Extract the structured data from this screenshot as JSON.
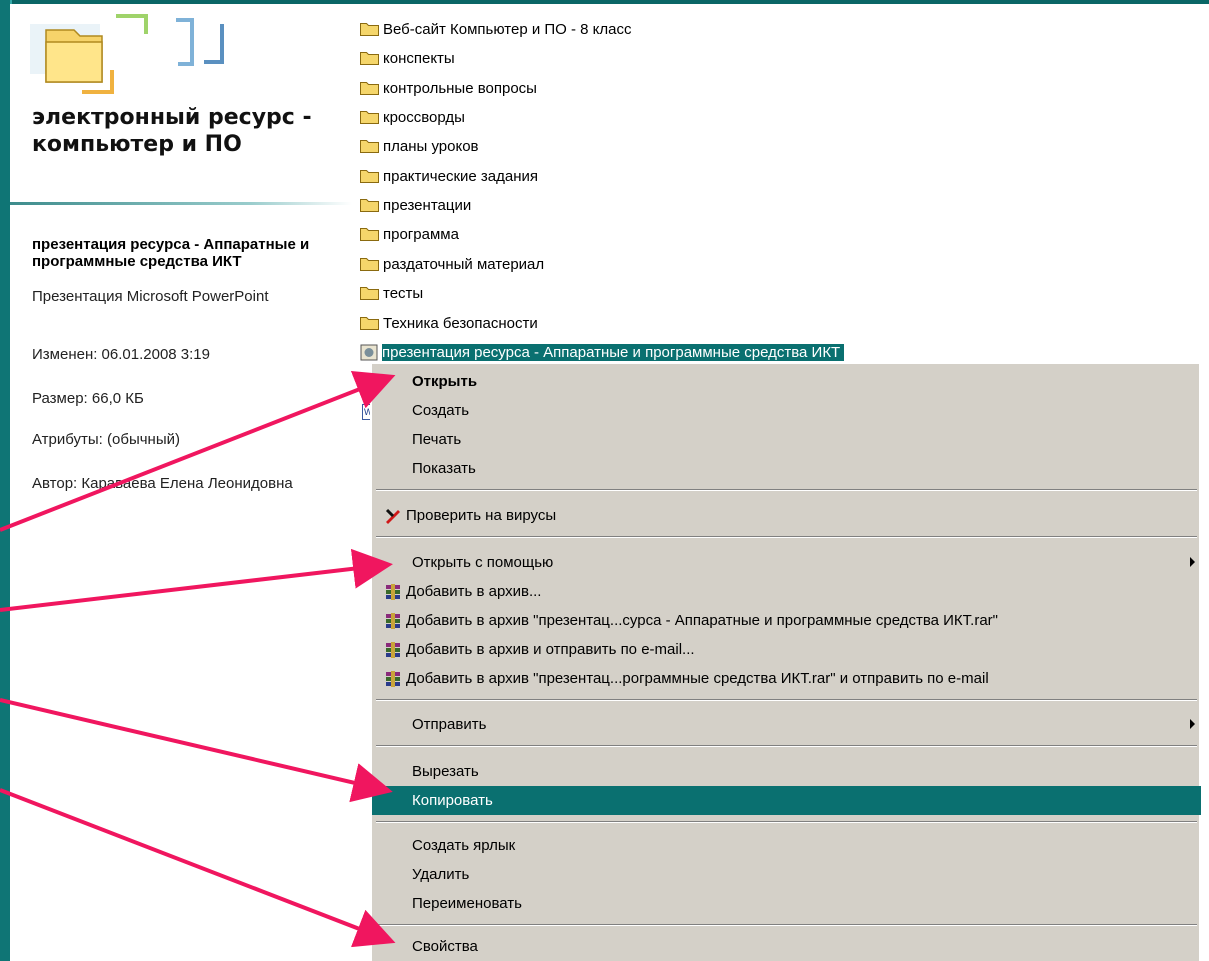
{
  "details_pane": {
    "title": "электронный ресурс - компьютер и ПО",
    "file_title": "презентация ресурса - Аппаратные и программные средства ИКТ",
    "file_type": "Презентация Microsoft PowerPoint",
    "modified": "Изменен: 06.01.2008 3:19",
    "size": "Размер: 66,0 КБ",
    "attributes": "Атрибуты: (обычный)",
    "author": "Автор: Караваева Елена Леонидовна"
  },
  "file_list": {
    "folders": [
      "Веб-сайт Компьютер и ПО - 8 класс",
      "конспекты",
      "контрольные вопросы",
      "кроссворды",
      "планы уроков",
      "практические задания",
      "презентации",
      "программа",
      "раздаточный материал",
      "тесты",
      "Техника безопасности"
    ],
    "selected_file": "презентация ресурса - Аппаратные и программные средства ИКТ",
    "icons": {
      "folder": "folder-icon",
      "presentation": "powerpoint-icon",
      "document": "word-document-icon"
    }
  },
  "context_menu": {
    "open": "Открыть",
    "create": "Создать",
    "print": "Печать",
    "show": "Показать",
    "virus_check": "Проверить на вирусы",
    "open_with": "Открыть с помощью",
    "add_to_archive": "Добавить в архив...",
    "add_to_named_archive": "Добавить в архив \"презентац...сурса - Аппаратные и программные средства ИКТ.rar\"",
    "add_and_email": "Добавить в архив и отправить по e-mail...",
    "add_named_and_email": "Добавить в архив \"презентац...рограммные средства ИКТ.rar\" и отправить по e-mail",
    "send_to": "Отправить",
    "cut": "Вырезать",
    "copy": "Копировать",
    "create_shortcut": "Создать ярлык",
    "delete": "Удалить",
    "rename": "Переименовать",
    "properties": "Свойства",
    "highlighted_item": "Копировать"
  },
  "colors": {
    "slide_background": "#0a6666",
    "selection": "#0a7070",
    "menu_background": "#d4d0c8",
    "annotation_arrow": "#f0165f"
  }
}
